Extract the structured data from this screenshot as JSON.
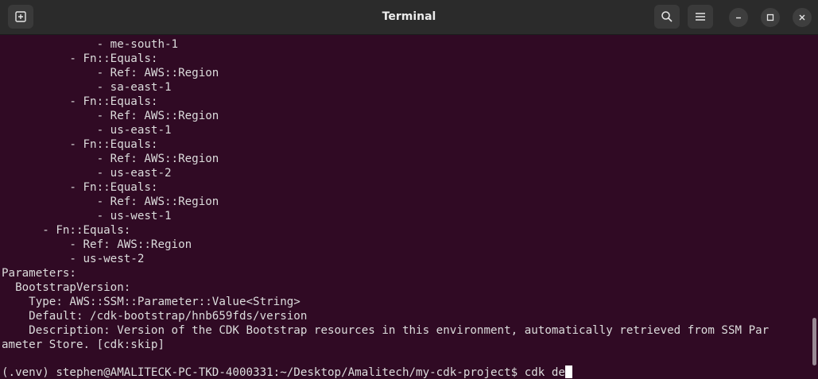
{
  "window": {
    "title": "Terminal"
  },
  "toolbar": {
    "new_tab_icon": "new-tab-icon",
    "search_icon": "search-icon",
    "menu_icon": "hamburger-icon",
    "minimize_icon": "minimize-icon",
    "maximize_icon": "maximize-icon",
    "close_icon": "close-icon"
  },
  "colors": {
    "background": "#300a24",
    "text": "#dcdcdc",
    "titlebar": "#2b2b2b"
  },
  "terminal": {
    "lines": [
      "              - me-south-1",
      "          - Fn::Equals:",
      "              - Ref: AWS::Region",
      "              - sa-east-1",
      "          - Fn::Equals:",
      "              - Ref: AWS::Region",
      "              - us-east-1",
      "          - Fn::Equals:",
      "              - Ref: AWS::Region",
      "              - us-east-2",
      "          - Fn::Equals:",
      "              - Ref: AWS::Region",
      "              - us-west-1",
      "      - Fn::Equals:",
      "          - Ref: AWS::Region",
      "          - us-west-2",
      "Parameters:",
      "  BootstrapVersion:",
      "    Type: AWS::SSM::Parameter::Value<String>",
      "    Default: /cdk-bootstrap/hnb659fds/version",
      "    Description: Version of the CDK Bootstrap resources in this environment, automatically retrieved from SSM Par",
      "ameter Store. [cdk:skip]",
      ""
    ],
    "prompt": "(.venv) stephen@AMALITECK-PC-TKD-4000331:~/Desktop/Amalitech/my-cdk-project$ ",
    "command": "cdk de"
  }
}
